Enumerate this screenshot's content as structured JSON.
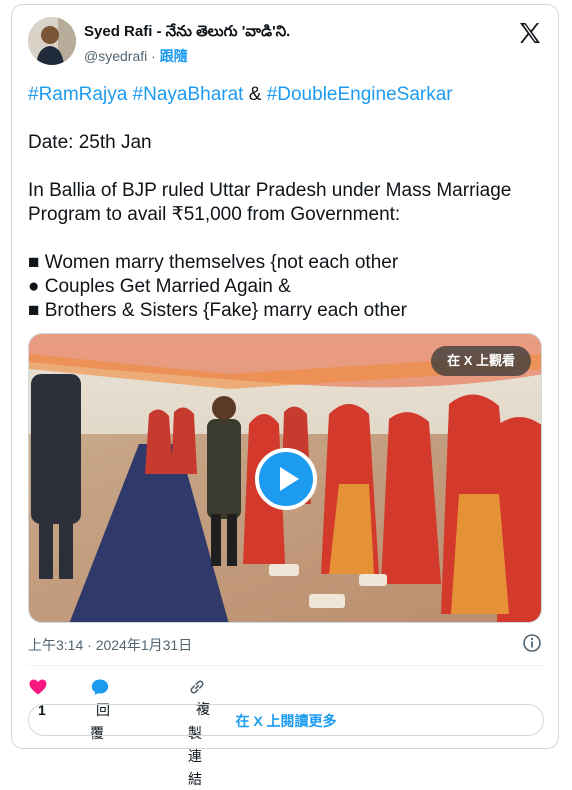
{
  "author": {
    "name": "Syed Rafi - నేను తెలుగు 'వాడి'ని.",
    "handle": "@syedrafi",
    "separator": "·",
    "follow_label": "跟隨"
  },
  "tweet": {
    "hashtags": [
      "#RamRajya",
      "#NayaBharat",
      "#DoubleEngineSarkar"
    ],
    "hashtag_joiner": "&",
    "date_line": "Date: 25th Jan",
    "paragraph": "In Ballia of BJP ruled Uttar Pradesh under Mass Marriage Program to avail ₹51,000 from Government:",
    "bullets": [
      "■ Women marry themselves {not each other",
      "● Couples Get Married Again &",
      "■ Brothers & Sisters {Fake} marry each other"
    ]
  },
  "media": {
    "watch_on_x_label": "在 X 上觀看"
  },
  "meta": {
    "timestamp": "上午3:14 · 2024年1月31日"
  },
  "actions": {
    "like_count": "1",
    "reply_label": "回覆",
    "copy_link_label": "複製連結"
  },
  "read_more_label": "在 X 上閱讀更多",
  "colors": {
    "accent": "#1d9bf0",
    "like": "#f91880",
    "text": "#0f1419",
    "muted": "#536471"
  }
}
